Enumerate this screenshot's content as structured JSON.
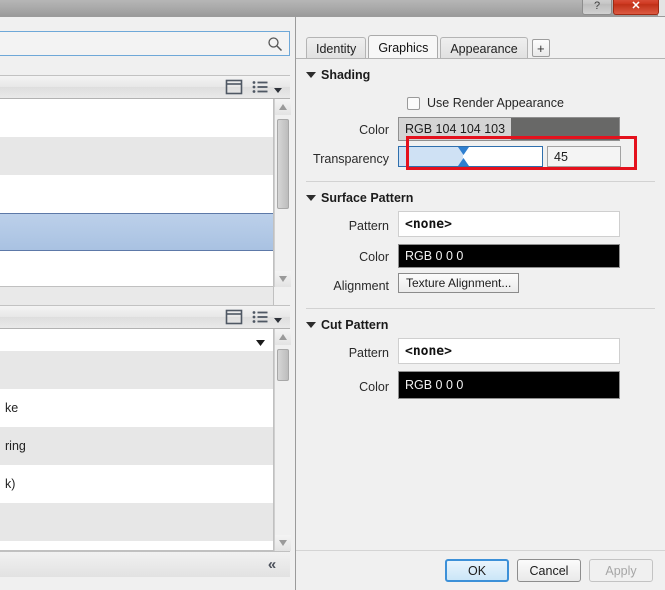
{
  "window": {
    "help_button": "?",
    "close_button": "✕"
  },
  "left_panel": {
    "search": {
      "value": "",
      "placeholder": "",
      "icon": "search-icon"
    },
    "toolbar_top": {
      "panel_icon": "panel-layout-icon",
      "list_icon": "list-view-icon",
      "caret_icon": "chevron-down-icon"
    },
    "toolbar_mid": {
      "panel_icon": "panel-layout-icon",
      "list_icon": "list-view-icon",
      "caret_icon": "chevron-down-icon"
    },
    "top_list": {
      "rows": [
        "",
        "",
        "",
        "",
        ""
      ]
    },
    "bottom_list": {
      "header_caret": "chevron-down-icon",
      "rows": [
        "",
        "ke",
        "ring",
        "k)",
        ""
      ]
    },
    "footer": {
      "collapse_label": "«"
    }
  },
  "right_panel": {
    "tabs": [
      {
        "label": "Identity",
        "active": false
      },
      {
        "label": "Graphics",
        "active": true
      },
      {
        "label": "Appearance",
        "active": false
      }
    ],
    "add_tab_label": "+",
    "sections": {
      "shading": {
        "title": "Shading",
        "use_render_appearance": {
          "label": "Use Render Appearance",
          "checked": false
        },
        "color": {
          "label": "Color",
          "value": "RGB 104 104 103",
          "swatch_hex": "#686867"
        },
        "transparency": {
          "label": "Transparency",
          "value": "45",
          "percent": 45
        }
      },
      "surface_pattern": {
        "title": "Surface Pattern",
        "pattern": {
          "label": "Pattern",
          "value": "<none>"
        },
        "color": {
          "label": "Color",
          "value": "RGB 0 0 0",
          "swatch_hex": "#000000"
        },
        "alignment": {
          "label": "Alignment",
          "button_label": "Texture Alignment..."
        }
      },
      "cut_pattern": {
        "title": "Cut Pattern",
        "pattern": {
          "label": "Pattern",
          "value": "<none>"
        },
        "color": {
          "label": "Color",
          "value": "RGB 0 0 0",
          "swatch_hex": "#000000"
        }
      }
    }
  },
  "buttons": {
    "ok": "OK",
    "cancel": "Cancel",
    "apply": "Apply"
  },
  "annotation": {
    "highlight_color": "#e4111d",
    "target": "transparency-slider"
  }
}
